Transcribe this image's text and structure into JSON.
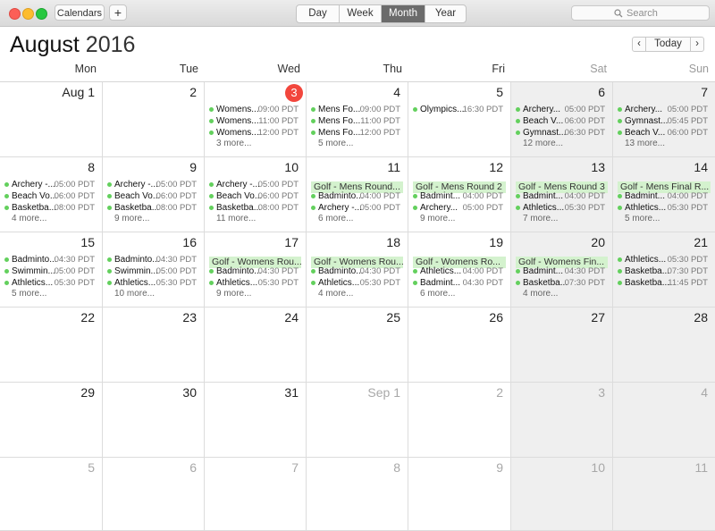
{
  "toolbar": {
    "calendars_label": "Calendars",
    "add_label": "+",
    "views": [
      "Day",
      "Week",
      "Month",
      "Year"
    ],
    "active_view": "Month",
    "search_placeholder": "Search"
  },
  "header": {
    "month": "August",
    "year": "2016",
    "prev": "‹",
    "today": "Today",
    "next": "›"
  },
  "weekdays": [
    "Mon",
    "Tue",
    "Wed",
    "Thu",
    "Fri",
    "Sat",
    "Sun"
  ],
  "weeks": [
    [
      {
        "label": "Aug 1",
        "events": []
      },
      {
        "label": "2",
        "events": []
      },
      {
        "label": "3",
        "today": true,
        "events": [
          {
            "name": "Womens...",
            "time": "09:00 PDT"
          },
          {
            "name": "Womens...",
            "time": "11:00 PDT"
          },
          {
            "name": "Womens...",
            "time": "12:00 PDT"
          }
        ],
        "more": "3 more..."
      },
      {
        "label": "4",
        "events": [
          {
            "name": "Mens Fo...",
            "time": "09:00 PDT"
          },
          {
            "name": "Mens Fo...",
            "time": "11:00 PDT"
          },
          {
            "name": "Mens Fo...",
            "time": "12:00 PDT"
          }
        ],
        "more": "5 more..."
      },
      {
        "label": "5",
        "events": [
          {
            "name": "Olympics...",
            "time": "16:30 PDT"
          }
        ]
      },
      {
        "label": "6",
        "events": [
          {
            "name": "Archery...",
            "time": "05:00 PDT"
          },
          {
            "name": "Beach V...",
            "time": "06:00 PDT"
          },
          {
            "name": "Gymnast...",
            "time": "06:30 PDT"
          }
        ],
        "more": "12 more..."
      },
      {
        "label": "7",
        "events": [
          {
            "name": "Archery...",
            "time": "05:00 PDT"
          },
          {
            "name": "Gymnast...",
            "time": "05:45 PDT"
          },
          {
            "name": "Beach V...",
            "time": "06:00 PDT"
          }
        ],
        "more": "13 more..."
      }
    ],
    [
      {
        "label": "8",
        "events": [
          {
            "name": "Archery -...",
            "time": "05:00 PDT"
          },
          {
            "name": "Beach Vo...",
            "time": "06:00 PDT"
          },
          {
            "name": "Basketba...",
            "time": "08:00 PDT"
          }
        ],
        "more": "4 more..."
      },
      {
        "label": "9",
        "events": [
          {
            "name": "Archery -...",
            "time": "05:00 PDT"
          },
          {
            "name": "Beach Vo...",
            "time": "06:00 PDT"
          },
          {
            "name": "Basketba...",
            "time": "08:00 PDT"
          }
        ],
        "more": "9 more..."
      },
      {
        "label": "10",
        "events": [
          {
            "name": "Archery -...",
            "time": "05:00 PDT"
          },
          {
            "name": "Beach Vo...",
            "time": "06:00 PDT"
          },
          {
            "name": "Basketba...",
            "time": "08:00 PDT"
          }
        ],
        "more": "11 more..."
      },
      {
        "label": "11",
        "allday": "Golf - Mens Round...",
        "events": [
          {
            "name": "Badminto...",
            "time": "04:00 PDT"
          },
          {
            "name": "Archery -...",
            "time": "05:00 PDT"
          }
        ],
        "more": "6 more..."
      },
      {
        "label": "12",
        "allday": "Golf - Mens Round 2",
        "events": [
          {
            "name": "Badmint...",
            "time": "04:00 PDT"
          },
          {
            "name": "Archery...",
            "time": "05:00 PDT"
          }
        ],
        "more": "9 more..."
      },
      {
        "label": "13",
        "allday": "Golf - Mens Round 3",
        "events": [
          {
            "name": "Badmint...",
            "time": "04:00 PDT"
          },
          {
            "name": "Athletics...",
            "time": "05:30 PDT"
          }
        ],
        "more": "7 more..."
      },
      {
        "label": "14",
        "allday": "Golf - Mens Final R...",
        "events": [
          {
            "name": "Badmint...",
            "time": "04:00 PDT"
          },
          {
            "name": "Athletics...",
            "time": "05:30 PDT"
          }
        ],
        "more": "5 more..."
      }
    ],
    [
      {
        "label": "15",
        "events": [
          {
            "name": "Badminto...",
            "time": "04:30 PDT"
          },
          {
            "name": "Swimmin...",
            "time": "05:00 PDT"
          },
          {
            "name": "Athletics...",
            "time": "05:30 PDT"
          }
        ],
        "more": "5 more..."
      },
      {
        "label": "16",
        "events": [
          {
            "name": "Badminto...",
            "time": "04:30 PDT"
          },
          {
            "name": "Swimmin...",
            "time": "05:00 PDT"
          },
          {
            "name": "Athletics...",
            "time": "05:30 PDT"
          }
        ],
        "more": "10 more..."
      },
      {
        "label": "17",
        "allday": "Golf - Womens Rou...",
        "events": [
          {
            "name": "Badminto...",
            "time": "04:30 PDT"
          },
          {
            "name": "Athletics...",
            "time": "05:30 PDT"
          }
        ],
        "more": "9 more..."
      },
      {
        "label": "18",
        "allday": "Golf - Womens Rou...",
        "events": [
          {
            "name": "Badminto...",
            "time": "04:30 PDT"
          },
          {
            "name": "Athletics...",
            "time": "05:30 PDT"
          }
        ],
        "more": "4 more..."
      },
      {
        "label": "19",
        "allday": "Golf - Womens Ro...",
        "events": [
          {
            "name": "Athletics...",
            "time": "04:00 PDT"
          },
          {
            "name": "Badmint...",
            "time": "04:30 PDT"
          }
        ],
        "more": "6 more..."
      },
      {
        "label": "20",
        "allday": "Golf - Womens Fin...",
        "events": [
          {
            "name": "Badmint...",
            "time": "04:30 PDT"
          },
          {
            "name": "Basketba...",
            "time": "07:30 PDT"
          }
        ],
        "more": "4 more..."
      },
      {
        "label": "21",
        "events": [
          {
            "name": "Athletics...",
            "time": "05:30 PDT"
          },
          {
            "name": "Basketba...",
            "time": "07:30 PDT"
          },
          {
            "name": "Basketba...",
            "time": "11:45 PDT"
          }
        ]
      }
    ],
    [
      {
        "label": "22",
        "events": []
      },
      {
        "label": "23",
        "events": []
      },
      {
        "label": "24",
        "events": []
      },
      {
        "label": "25",
        "events": []
      },
      {
        "label": "26",
        "events": []
      },
      {
        "label": "27",
        "events": []
      },
      {
        "label": "28",
        "events": []
      }
    ],
    [
      {
        "label": "29",
        "events": []
      },
      {
        "label": "30",
        "events": []
      },
      {
        "label": "31",
        "events": []
      },
      {
        "label": "Sep 1",
        "dim": true,
        "events": []
      },
      {
        "label": "2",
        "dim": true,
        "events": []
      },
      {
        "label": "3",
        "dim": true,
        "events": []
      },
      {
        "label": "4",
        "dim": true,
        "events": []
      }
    ],
    [
      {
        "label": "5",
        "dim": true,
        "events": []
      },
      {
        "label": "6",
        "dim": true,
        "events": []
      },
      {
        "label": "7",
        "dim": true,
        "events": []
      },
      {
        "label": "8",
        "dim": true,
        "events": []
      },
      {
        "label": "9",
        "dim": true,
        "events": []
      },
      {
        "label": "10",
        "dim": true,
        "events": []
      },
      {
        "label": "11",
        "dim": true,
        "events": []
      }
    ]
  ],
  "colors": {
    "event_dot": "#63d05d",
    "allday_bg": "#d4f2ce",
    "today_circle": "#f2463c",
    "weekend_bg": "#efefef"
  }
}
